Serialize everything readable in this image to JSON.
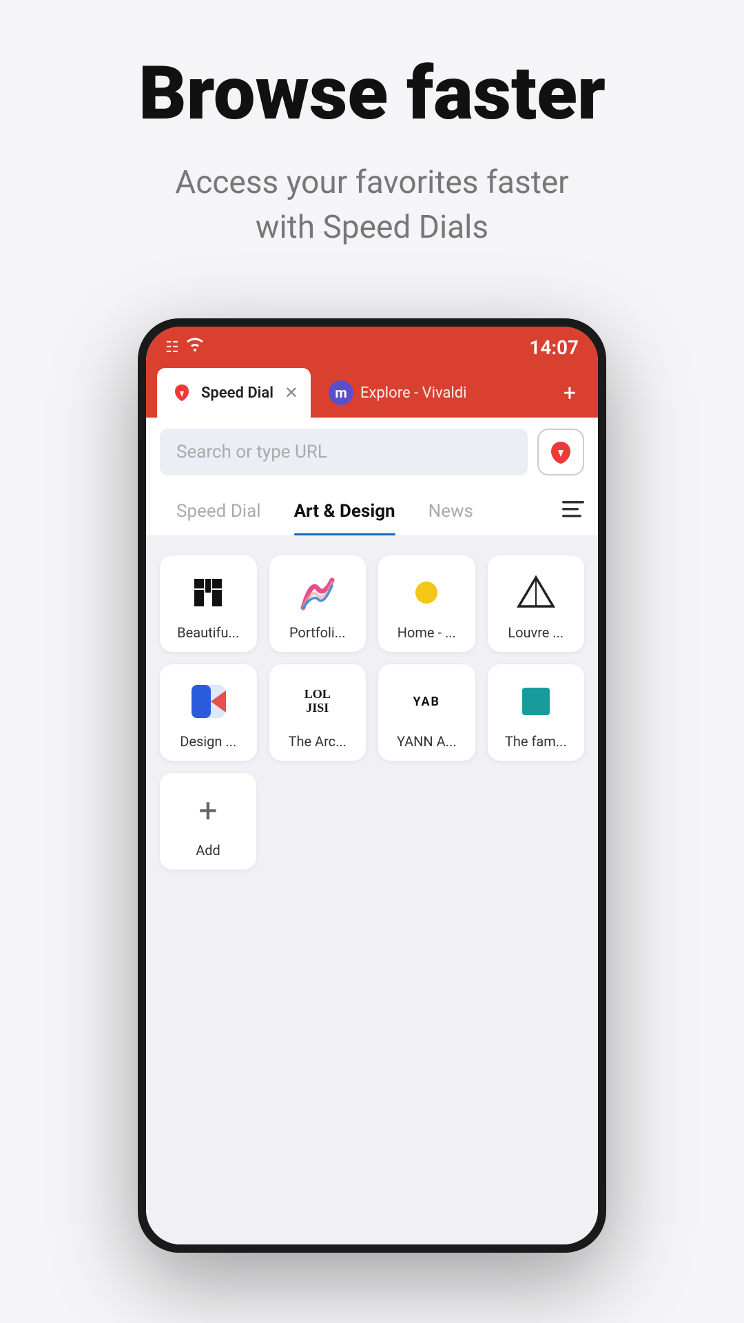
{
  "hero": {
    "title": "Browse faster",
    "subtitle": "Access your favorites faster\nwith Speed Dials"
  },
  "phone": {
    "statusBar": {
      "time": "14:07"
    },
    "tabs": [
      {
        "label": "Speed Dial",
        "active": true,
        "id": "speed-dial-tab"
      },
      {
        "label": "Explore - Vivaldi",
        "active": false,
        "id": "explore-tab"
      }
    ],
    "addTabLabel": "+",
    "searchBar": {
      "placeholder": "Search or type URL"
    },
    "navTabs": [
      {
        "label": "Speed Dial",
        "active": false
      },
      {
        "label": "Art & Design",
        "active": true
      },
      {
        "label": "News",
        "active": false
      }
    ],
    "speedDials": [
      {
        "row": 1,
        "items": [
          {
            "id": "beautifulu",
            "label": "Beautifu...",
            "iconType": "unsplash"
          },
          {
            "id": "portfolioli",
            "label": "Portfoli...",
            "iconType": "portfolio"
          },
          {
            "id": "home",
            "label": "Home - ...",
            "iconType": "dot"
          },
          {
            "id": "louvre",
            "label": "Louvre ...",
            "iconType": "pyramid"
          }
        ]
      },
      {
        "row": 2,
        "items": [
          {
            "id": "design",
            "label": "Design ...",
            "iconType": "design"
          },
          {
            "id": "arc",
            "label": "The Arc...",
            "iconType": "loujisi"
          },
          {
            "id": "yann",
            "label": "YANN A...",
            "iconType": "yab"
          },
          {
            "id": "fam",
            "label": "The fam...",
            "iconType": "teal"
          }
        ]
      }
    ],
    "addButton": {
      "label": "Add"
    }
  }
}
